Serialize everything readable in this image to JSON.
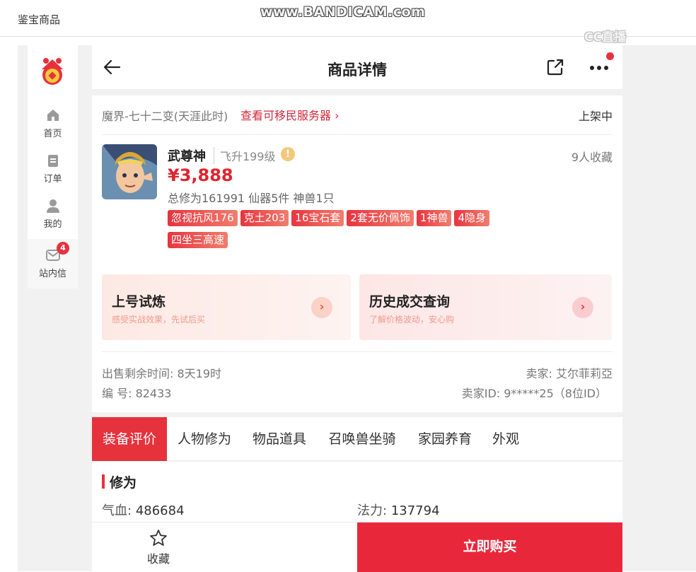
{
  "window": {
    "title": "鉴宝商品"
  },
  "watermark": {
    "main": "www.BANDICAM.com",
    "corner": "CC直播"
  },
  "leftnav": {
    "items": [
      {
        "label": "首页",
        "icon": "home-icon"
      },
      {
        "label": "订单",
        "icon": "order-icon"
      },
      {
        "label": "我的",
        "icon": "user-icon"
      },
      {
        "label": "站内信",
        "icon": "mail-icon",
        "badge": "4"
      }
    ]
  },
  "header": {
    "title": "商品详情"
  },
  "product": {
    "server": "魔界-七十二变(天涯此时)",
    "server_link": "查看可移民服务器",
    "status": "上架中",
    "name": "武尊神",
    "level": "飞升199级",
    "fav_count": "9人收藏",
    "price": "¥3,888",
    "summary": "总修为161991 仙器5件 神兽1只",
    "tags": [
      "忽视抗风176",
      "克土203",
      "16宝石套",
      "2套无价佩饰",
      "1神兽",
      "4隐身",
      "四坐三高速"
    ]
  },
  "promos": [
    {
      "title": "上号试炼",
      "subtitle": "感受实战效果，先试后买"
    },
    {
      "title": "历史成交查询",
      "subtitle": "了解价格波动，安心购"
    }
  ],
  "meta": {
    "remaining": "出售剩余时间: 8天19时",
    "number": "编 号: 82433",
    "seller": "卖家: 艾尔菲莉亞",
    "seller_id": "卖家ID: 9*****25（8位ID）"
  },
  "tabs": [
    "装备评价",
    "人物修为",
    "物品道具",
    "召唤兽坐骑",
    "家园养育",
    "外观"
  ],
  "section": {
    "title": "修为",
    "stats": [
      {
        "key": "气血:",
        "value": "486684"
      },
      {
        "key": "法力:",
        "value": "137794"
      }
    ]
  },
  "bottom": {
    "fav_label": "收藏",
    "buy_label": "立即购买"
  },
  "colors": {
    "accent": "#e5323c",
    "price": "#e0242f"
  }
}
